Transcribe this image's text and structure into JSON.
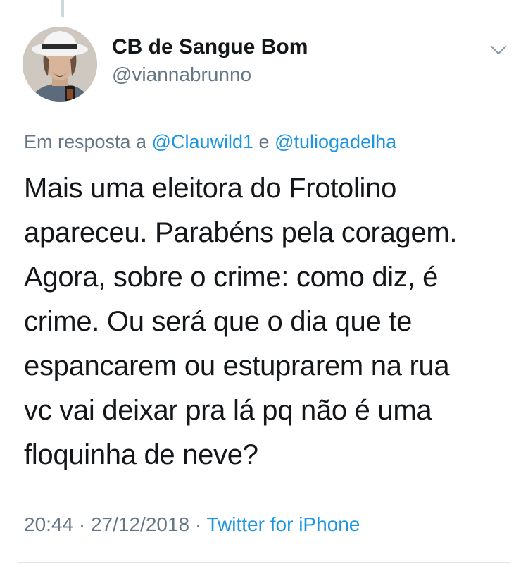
{
  "author": {
    "display_name": "CB de Sangue Bom",
    "username": "@viannabrunno",
    "avatar_icon": "profile-photo"
  },
  "reply": {
    "prefix": "Em resposta a ",
    "mention_1": "@Clauwild1",
    "joiner": " e ",
    "mention_2": "@tuliogadelha"
  },
  "tweet": {
    "lines": [
      "Mais uma eleitora do Frotolino",
      "apareceu. Parabéns pela coragem.",
      "Agora, sobre o crime: como diz, é",
      "crime. Ou será que o dia que te",
      "espancarem ou estuprarem na rua",
      "vc vai deixar pra lá pq não é uma",
      "floquinha de neve?"
    ]
  },
  "meta": {
    "time": "20:44",
    "separator_1": " · ",
    "date": "27/12/2018",
    "separator_2": " · ",
    "source": "Twitter for iPhone"
  },
  "colors": {
    "text": "#14171a",
    "secondary": "#657786",
    "link": "#1b95e0",
    "border": "#e1e8ed"
  },
  "icons": {
    "menu": "chevron-down-icon"
  }
}
